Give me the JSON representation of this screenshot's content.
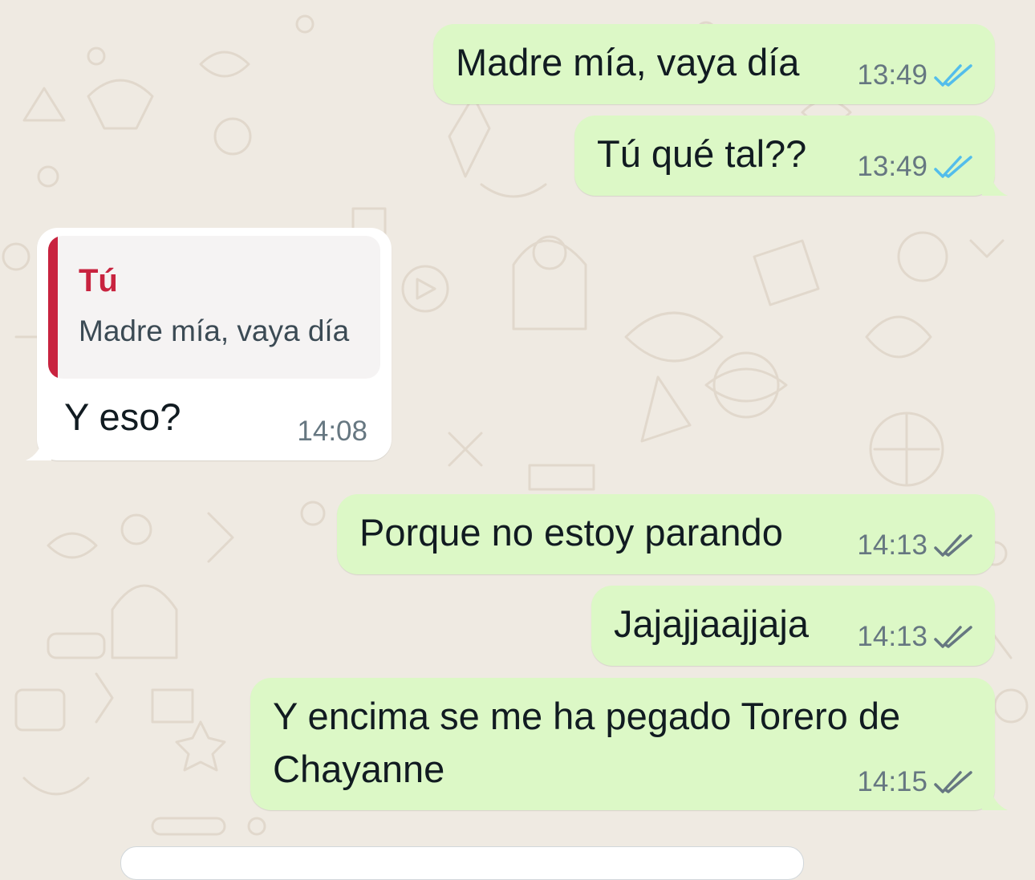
{
  "colors": {
    "outgoing_bubble": "#dcf8c6",
    "incoming_bubble": "#ffffff",
    "read_ticks": "#53bdeb",
    "delivered_ticks": "#667781",
    "quote_accent": "#c8233f",
    "background": "#efeae2"
  },
  "messages": [
    {
      "direction": "out",
      "text": "Madre mía, vaya día",
      "time": "13:49",
      "status": "read",
      "status_icon": "double-check-blue-icon"
    },
    {
      "direction": "out",
      "text": "Tú qué tal??",
      "time": "13:49",
      "status": "read",
      "status_icon": "double-check-blue-icon"
    },
    {
      "direction": "in",
      "quote": {
        "author": "Tú",
        "text": "Madre mía, vaya día"
      },
      "text": "Y eso?",
      "time": "14:08"
    },
    {
      "direction": "out",
      "text": "Porque no estoy parando",
      "time": "14:13",
      "status": "delivered",
      "status_icon": "double-check-gray-icon"
    },
    {
      "direction": "out",
      "text": "Jajajjaajjaja",
      "time": "14:13",
      "status": "delivered",
      "status_icon": "double-check-gray-icon"
    },
    {
      "direction": "out",
      "text_line1": "Y encima se me ha pegado Torero  de",
      "text_line2": "Chayanne",
      "time": "14:15",
      "status": "delivered",
      "status_icon": "double-check-gray-icon"
    }
  ]
}
